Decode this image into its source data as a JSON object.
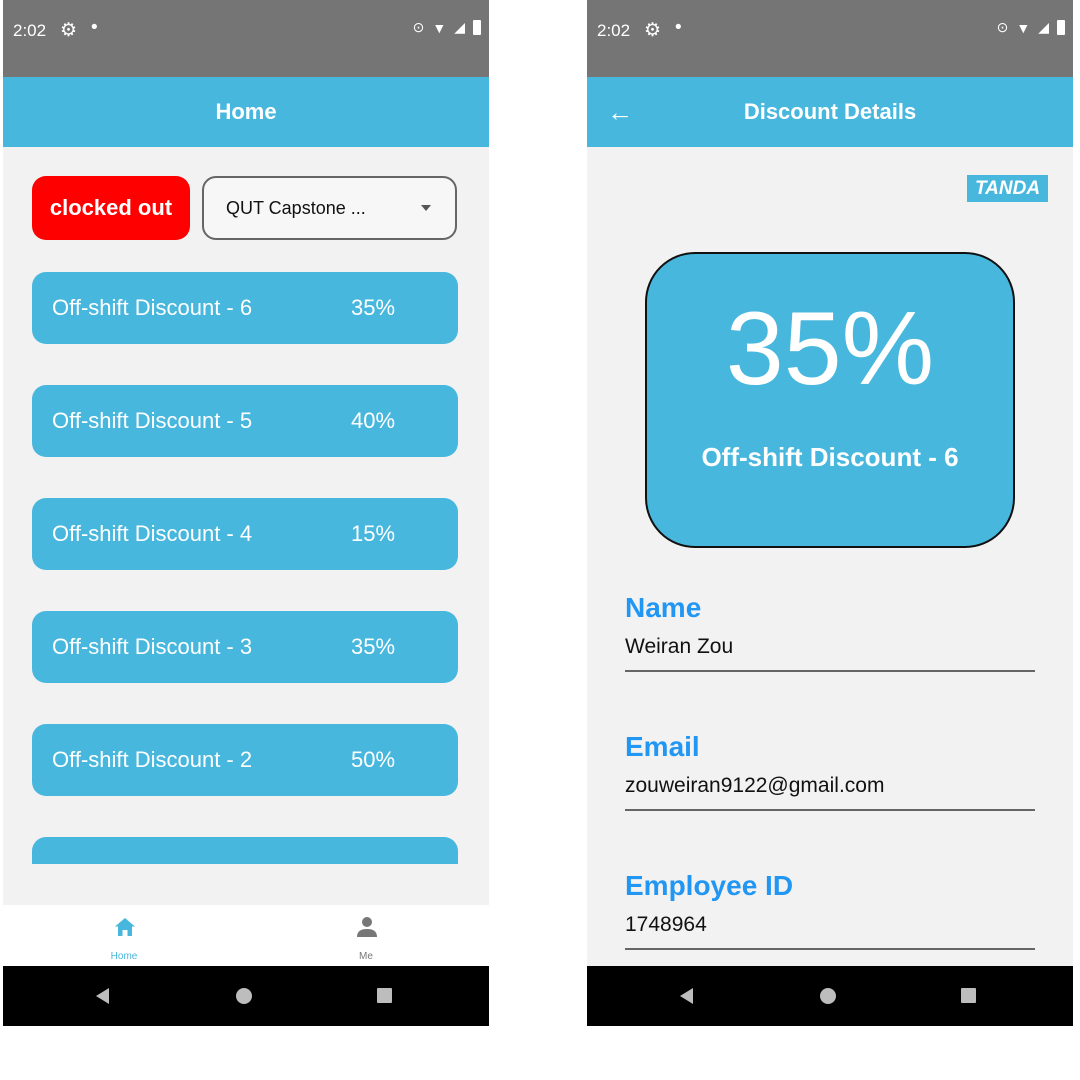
{
  "status_bar": {
    "time": "2:02"
  },
  "home": {
    "title": "Home",
    "clock_status": "clocked out",
    "location": {
      "selected": "QUT Capstone ..."
    },
    "discounts": [
      {
        "name": "Off-shift Discount - 6",
        "percent": "35%"
      },
      {
        "name": "Off-shift Discount - 5",
        "percent": "40%"
      },
      {
        "name": "Off-shift Discount - 4",
        "percent": "15%"
      },
      {
        "name": "Off-shift Discount - 3",
        "percent": "35%"
      },
      {
        "name": "Off-shift Discount - 2",
        "percent": "50%"
      },
      {
        "name": "",
        "percent": ""
      }
    ],
    "bottom_nav": [
      {
        "label": "Home",
        "icon": "home-icon",
        "active": true
      },
      {
        "label": "Me",
        "icon": "person-icon",
        "active": false
      }
    ]
  },
  "details": {
    "title": "Discount Details",
    "logo_text": "TANDA",
    "discount_percent": "35%",
    "discount_name": "Off-shift Discount - 6",
    "fields": {
      "name": {
        "label": "Name",
        "value": "Weiran Zou"
      },
      "email": {
        "label": "Email",
        "value": "zouweiran9122@gmail.com"
      },
      "employee_id": {
        "label": "Employee ID",
        "value": "1748964"
      }
    }
  },
  "colors": {
    "accent": "#48b7dd",
    "status_bar": "#757575",
    "clocked_out": "#ff0000",
    "field_label": "#2196f3"
  },
  "icons": [
    "settings-icon",
    "location-icon",
    "wifi-icon",
    "signal-icon",
    "battery-icon",
    "back-arrow-icon",
    "dropdown-caret-icon",
    "home-icon",
    "person-icon",
    "nav-back-icon",
    "nav-home-icon",
    "nav-recents-icon"
  ]
}
